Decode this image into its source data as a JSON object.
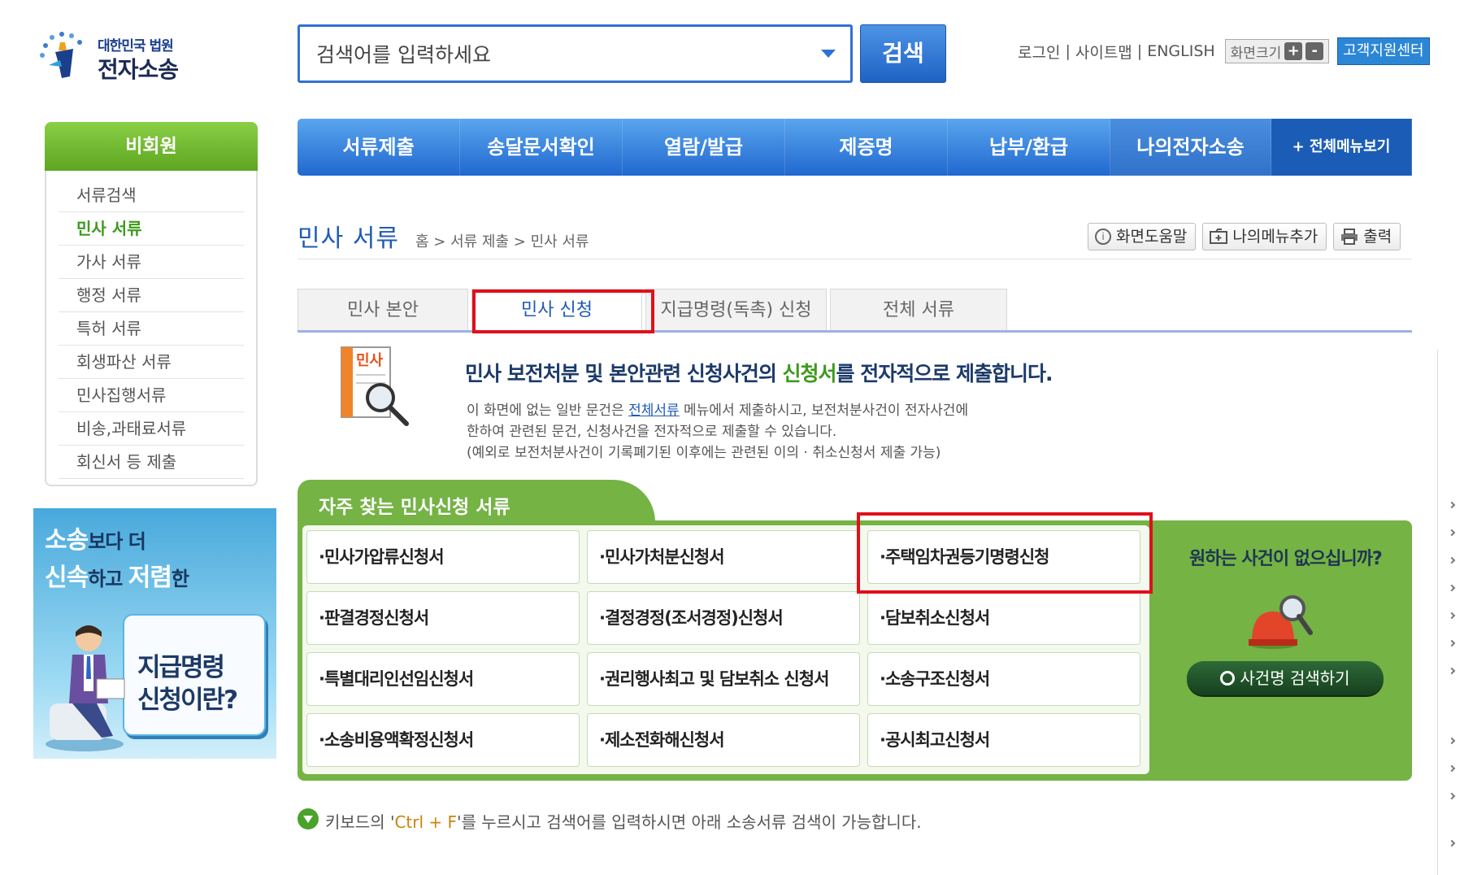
{
  "logo": {
    "line1": "대한민국 법원",
    "line2": "전자소송"
  },
  "search": {
    "placeholder": "검색어를 입력하세요",
    "button_label": "검색"
  },
  "util": {
    "login": "로그인",
    "sitemap": "사이트맵",
    "english": "ENGLISH",
    "sep": "|",
    "font_size_label": "화면크기",
    "plus": "+",
    "minus": "-",
    "customer_center": "고객지원센터"
  },
  "sidebar": {
    "title": "비회원",
    "items": [
      {
        "label": "서류검색"
      },
      {
        "label": "민사 서류"
      },
      {
        "label": "가사 서류"
      },
      {
        "label": "행정 서류"
      },
      {
        "label": "특허 서류"
      },
      {
        "label": "회생파산 서류"
      },
      {
        "label": "민사집행서류"
      },
      {
        "label": "비송,과태료서류"
      },
      {
        "label": "회신서 등 제출"
      }
    ],
    "active_index": 1
  },
  "banner": {
    "line1_big": "소송",
    "line1_small": "보다 더",
    "line2_a": "신속",
    "line2_b": "하고 ",
    "line2_c": "저렴",
    "line2_d": "한",
    "card_line1": "지급명령",
    "card_line2": "신청이란?"
  },
  "topnav": {
    "items": [
      {
        "label": "서류제출"
      },
      {
        "label": "송달문서확인"
      },
      {
        "label": "열람/발급"
      },
      {
        "label": "제증명"
      },
      {
        "label": "납부/환급"
      },
      {
        "label": "나의전자소송"
      }
    ],
    "all_menu": "+ 전체메뉴보기"
  },
  "page": {
    "title": "민사 서류",
    "breadcrumb": "홈 > 서류 제출 > 민사 서류",
    "help_btn": "화면도움말",
    "add_menu_btn": "나의메뉴추가",
    "print_btn": "출력"
  },
  "tabs": [
    {
      "label": "민사 본안"
    },
    {
      "label": "민사 신청"
    },
    {
      "label": "지급명령(독촉) 신청"
    },
    {
      "label": "전체 서류"
    }
  ],
  "active_tab": 1,
  "info": {
    "icon_label": "민사",
    "headline_a": "민사 보전처분 및 본안관련 신청사건의 ",
    "headline_b": "신청서",
    "headline_c": "를 전자적으로 제출합니다.",
    "desc_1a": "이 화면에 없는 일반 문건은 ",
    "desc_1b": "전체서류",
    "desc_1c": " 메뉴에서 제출하시고, 보전처분사건이 전자사건에",
    "desc_2": "한하여 관련된 문건, 신청사건을 전자적으로 제출할 수 있습니다.",
    "desc_3": "(예외로 보전처분사건이 기록폐기된 이후에는 관련된 이의 · 취소신청서 제출 가능)"
  },
  "frequent": {
    "title": "자주 찾는 민사신청 서류",
    "rows": [
      [
        "·민사가압류신청서",
        "·민사가처분신청서",
        "·주택임차권등기명령신청"
      ],
      [
        "·판결경정신청서",
        "·결정경정(조서경정)신청서",
        "·담보취소신청서"
      ],
      [
        "·특별대리인선임신청서",
        "·권리행사최고 및 담보취소 신청서",
        "·소송구조신청서"
      ],
      [
        "·소송비용액확정신청서",
        "·제소전화해신청서",
        "·공시최고신청서"
      ]
    ],
    "no_case_question": "원하는 사건이 없으십니까?",
    "case_search_btn": "사건명 검색하기"
  },
  "hint": {
    "a": "키보드의 '",
    "b": "Ctrl + F",
    "c": "'를 누르시고 검색어를 입력하시면 아래 소송서류 검색이 가능합니다."
  },
  "colors": {
    "primary_blue": "#2f72d3",
    "green": "#74b344",
    "highlight_red": "#e0101a",
    "active_green_text": "#3d9a1c"
  }
}
